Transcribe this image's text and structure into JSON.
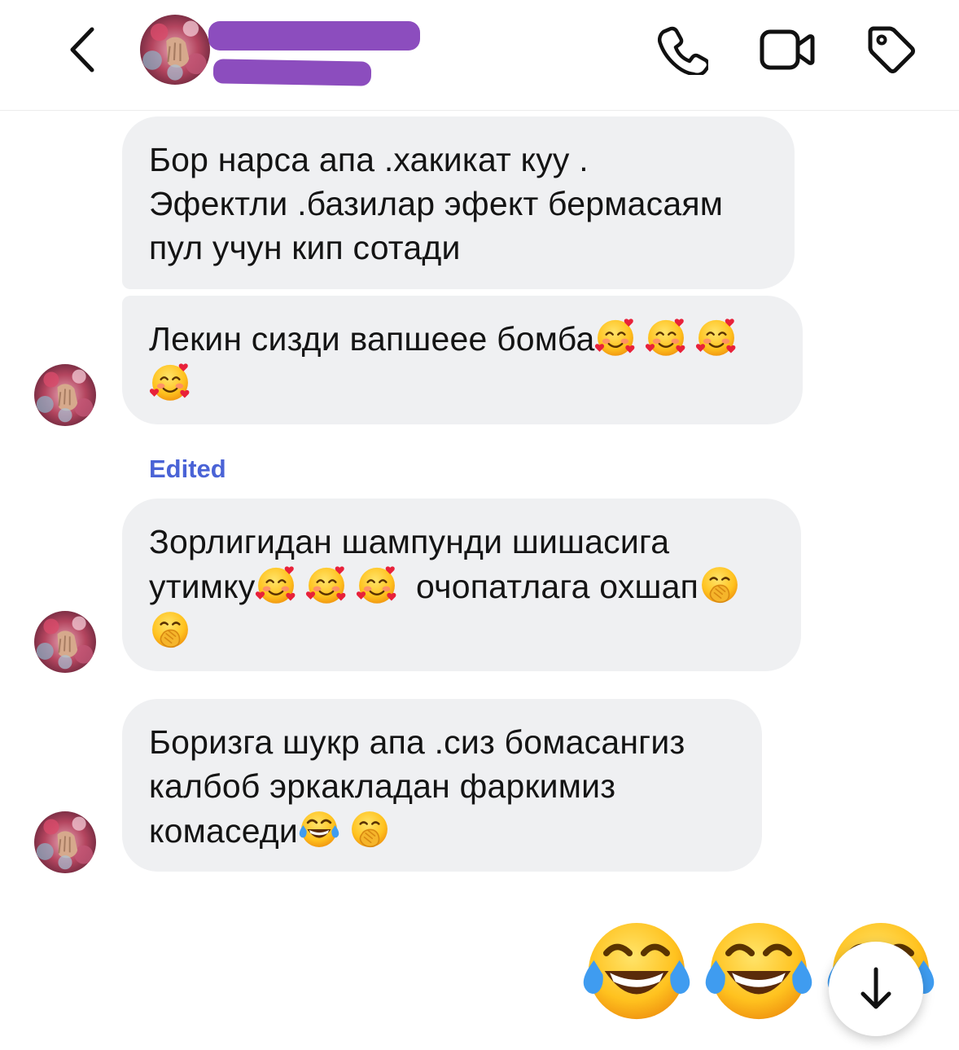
{
  "header": {
    "back_icon": "chevron-left-icon",
    "call_icon": "phone-icon",
    "video_icon": "video-camera-icon",
    "tag_icon": "tag-icon"
  },
  "messages": [
    {
      "lines": [
        "Бор нарса апа .хакикат куу  .",
        "Эфектли .базилар эфект бермасаям",
        "пул учун кип сотади"
      ]
    },
    {
      "lines": [
        "Лекин сизди вапшеее бомба"
      ],
      "emoji": [
        "smiling-face-with-hearts",
        "smiling-face-with-hearts",
        "smiling-face-with-hearts",
        "smiling-face-with-hearts"
      ]
    },
    {
      "lines": [
        "Зорлигидан шампунди шишасига",
        "утимку",
        " очопатлага охшап"
      ],
      "emoji": [
        "smiling-face-with-hearts",
        "smiling-face-with-hearts",
        "smiling-face-with-hearts",
        "face-with-hand-over-mouth",
        "face-with-hand-over-mouth"
      ]
    },
    {
      "lines": [
        "Боризга шукр апа .сиз бомасангиз",
        "калбоб эркакладан фаркимиз",
        "комаседи"
      ],
      "emoji": [
        "face-with-tears-of-joy",
        "face-with-hand-over-mouth"
      ]
    }
  ],
  "edited_label": "Edited",
  "reactions": [
    "face-with-tears-of-joy",
    "face-with-tears-of-joy",
    "face-with-tears-of-joy"
  ],
  "scroll_icon": "arrow-down-icon",
  "colors": {
    "bubble": "#eff0f2",
    "edited": "#4a63d6",
    "redaction": "#8c4dbe"
  }
}
